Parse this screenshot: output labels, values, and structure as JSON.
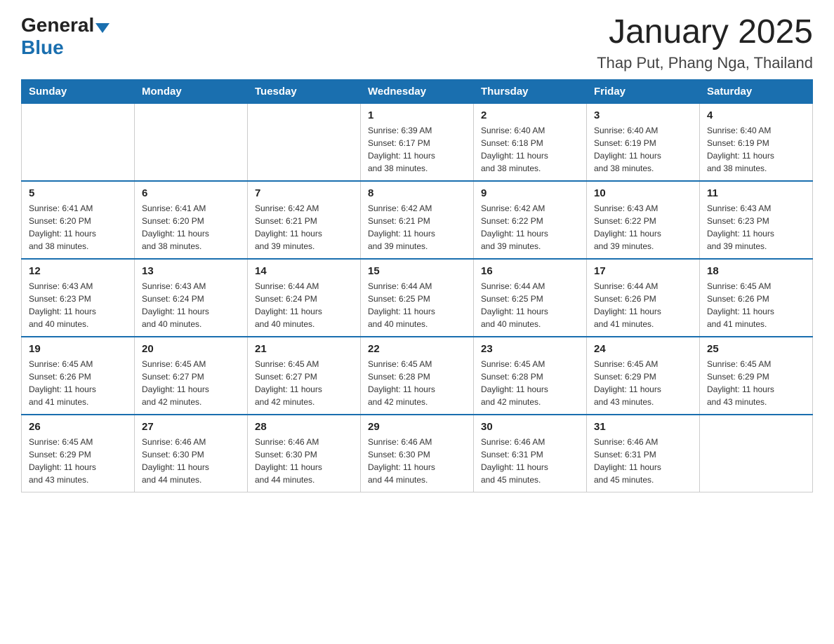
{
  "header": {
    "logo_general": "General",
    "logo_blue": "Blue",
    "title": "January 2025",
    "subtitle": "Thap Put, Phang Nga, Thailand"
  },
  "columns": [
    "Sunday",
    "Monday",
    "Tuesday",
    "Wednesday",
    "Thursday",
    "Friday",
    "Saturday"
  ],
  "weeks": [
    [
      {
        "day": "",
        "info": ""
      },
      {
        "day": "",
        "info": ""
      },
      {
        "day": "",
        "info": ""
      },
      {
        "day": "1",
        "info": "Sunrise: 6:39 AM\nSunset: 6:17 PM\nDaylight: 11 hours\nand 38 minutes."
      },
      {
        "day": "2",
        "info": "Sunrise: 6:40 AM\nSunset: 6:18 PM\nDaylight: 11 hours\nand 38 minutes."
      },
      {
        "day": "3",
        "info": "Sunrise: 6:40 AM\nSunset: 6:19 PM\nDaylight: 11 hours\nand 38 minutes."
      },
      {
        "day": "4",
        "info": "Sunrise: 6:40 AM\nSunset: 6:19 PM\nDaylight: 11 hours\nand 38 minutes."
      }
    ],
    [
      {
        "day": "5",
        "info": "Sunrise: 6:41 AM\nSunset: 6:20 PM\nDaylight: 11 hours\nand 38 minutes."
      },
      {
        "day": "6",
        "info": "Sunrise: 6:41 AM\nSunset: 6:20 PM\nDaylight: 11 hours\nand 38 minutes."
      },
      {
        "day": "7",
        "info": "Sunrise: 6:42 AM\nSunset: 6:21 PM\nDaylight: 11 hours\nand 39 minutes."
      },
      {
        "day": "8",
        "info": "Sunrise: 6:42 AM\nSunset: 6:21 PM\nDaylight: 11 hours\nand 39 minutes."
      },
      {
        "day": "9",
        "info": "Sunrise: 6:42 AM\nSunset: 6:22 PM\nDaylight: 11 hours\nand 39 minutes."
      },
      {
        "day": "10",
        "info": "Sunrise: 6:43 AM\nSunset: 6:22 PM\nDaylight: 11 hours\nand 39 minutes."
      },
      {
        "day": "11",
        "info": "Sunrise: 6:43 AM\nSunset: 6:23 PM\nDaylight: 11 hours\nand 39 minutes."
      }
    ],
    [
      {
        "day": "12",
        "info": "Sunrise: 6:43 AM\nSunset: 6:23 PM\nDaylight: 11 hours\nand 40 minutes."
      },
      {
        "day": "13",
        "info": "Sunrise: 6:43 AM\nSunset: 6:24 PM\nDaylight: 11 hours\nand 40 minutes."
      },
      {
        "day": "14",
        "info": "Sunrise: 6:44 AM\nSunset: 6:24 PM\nDaylight: 11 hours\nand 40 minutes."
      },
      {
        "day": "15",
        "info": "Sunrise: 6:44 AM\nSunset: 6:25 PM\nDaylight: 11 hours\nand 40 minutes."
      },
      {
        "day": "16",
        "info": "Sunrise: 6:44 AM\nSunset: 6:25 PM\nDaylight: 11 hours\nand 40 minutes."
      },
      {
        "day": "17",
        "info": "Sunrise: 6:44 AM\nSunset: 6:26 PM\nDaylight: 11 hours\nand 41 minutes."
      },
      {
        "day": "18",
        "info": "Sunrise: 6:45 AM\nSunset: 6:26 PM\nDaylight: 11 hours\nand 41 minutes."
      }
    ],
    [
      {
        "day": "19",
        "info": "Sunrise: 6:45 AM\nSunset: 6:26 PM\nDaylight: 11 hours\nand 41 minutes."
      },
      {
        "day": "20",
        "info": "Sunrise: 6:45 AM\nSunset: 6:27 PM\nDaylight: 11 hours\nand 42 minutes."
      },
      {
        "day": "21",
        "info": "Sunrise: 6:45 AM\nSunset: 6:27 PM\nDaylight: 11 hours\nand 42 minutes."
      },
      {
        "day": "22",
        "info": "Sunrise: 6:45 AM\nSunset: 6:28 PM\nDaylight: 11 hours\nand 42 minutes."
      },
      {
        "day": "23",
        "info": "Sunrise: 6:45 AM\nSunset: 6:28 PM\nDaylight: 11 hours\nand 42 minutes."
      },
      {
        "day": "24",
        "info": "Sunrise: 6:45 AM\nSunset: 6:29 PM\nDaylight: 11 hours\nand 43 minutes."
      },
      {
        "day": "25",
        "info": "Sunrise: 6:45 AM\nSunset: 6:29 PM\nDaylight: 11 hours\nand 43 minutes."
      }
    ],
    [
      {
        "day": "26",
        "info": "Sunrise: 6:45 AM\nSunset: 6:29 PM\nDaylight: 11 hours\nand 43 minutes."
      },
      {
        "day": "27",
        "info": "Sunrise: 6:46 AM\nSunset: 6:30 PM\nDaylight: 11 hours\nand 44 minutes."
      },
      {
        "day": "28",
        "info": "Sunrise: 6:46 AM\nSunset: 6:30 PM\nDaylight: 11 hours\nand 44 minutes."
      },
      {
        "day": "29",
        "info": "Sunrise: 6:46 AM\nSunset: 6:30 PM\nDaylight: 11 hours\nand 44 minutes."
      },
      {
        "day": "30",
        "info": "Sunrise: 6:46 AM\nSunset: 6:31 PM\nDaylight: 11 hours\nand 45 minutes."
      },
      {
        "day": "31",
        "info": "Sunrise: 6:46 AM\nSunset: 6:31 PM\nDaylight: 11 hours\nand 45 minutes."
      },
      {
        "day": "",
        "info": ""
      }
    ]
  ]
}
